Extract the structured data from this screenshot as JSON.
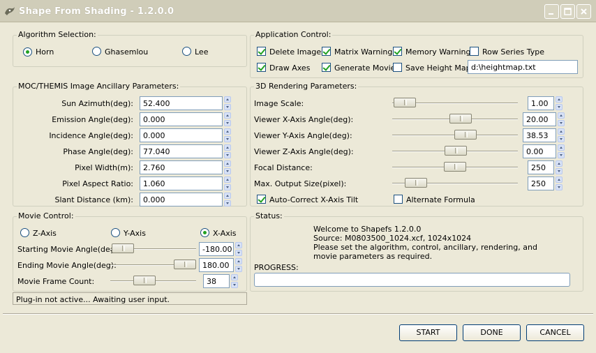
{
  "window": {
    "title": "Shape From Shading - 1.2.0.0"
  },
  "algorithm": {
    "legend": "Algorithm Selection:",
    "options": [
      "Horn",
      "Ghasemlou",
      "Lee"
    ],
    "selected": "Horn"
  },
  "app_control": {
    "legend": "Application Control:",
    "delete_images": {
      "label": "Delete Images",
      "checked": true
    },
    "matrix_warnings": {
      "label": "Matrix Warnings",
      "checked": true
    },
    "memory_warnings": {
      "label": "Memory Warnings",
      "checked": true
    },
    "row_series_type": {
      "label": "Row Series Type",
      "checked": false
    },
    "draw_axes": {
      "label": "Draw Axes",
      "checked": true
    },
    "generate_movie": {
      "label": "Generate Movie",
      "checked": true
    },
    "save_height_map": {
      "label": "Save Height Map",
      "checked": false
    },
    "height_map_path": "d:\\heightmap.txt"
  },
  "ancillary": {
    "legend": "MOC/THEMIS Image Ancillary Parameters:",
    "params": [
      {
        "label": "Sun Azimuth(deg):",
        "value": "52.400"
      },
      {
        "label": "Emission Angle(deg):",
        "value": "0.000"
      },
      {
        "label": "Incidence Angle(deg):",
        "value": "0.000"
      },
      {
        "label": "Phase Angle(deg):",
        "value": "77.040"
      },
      {
        "label": "Pixel Width(m):",
        "value": "2.760"
      },
      {
        "label": "Pixel Aspect Ratio:",
        "value": "1.060"
      },
      {
        "label": "Slant Distance (km):",
        "value": "0.000"
      }
    ]
  },
  "rendering": {
    "legend": "3D Rendering Parameters:",
    "params": [
      {
        "label": "Image Scale:",
        "value": "1.00"
      },
      {
        "label": "Viewer X-Axis Angle(deg):",
        "value": "20.00"
      },
      {
        "label": "Viewer Y-Axis Angle(deg):",
        "value": "38.53"
      },
      {
        "label": "Viewer Z-Axis Angle(deg):",
        "value": "0.00"
      },
      {
        "label": "Focal Distance:",
        "value": "250"
      },
      {
        "label": "Max. Output Size(pixel):",
        "value": "250"
      }
    ],
    "auto_correct": {
      "label": "Auto-Correct X-Axis Tilt",
      "checked": true
    },
    "alternate_formula": {
      "label": "Alternate Formula",
      "checked": false
    }
  },
  "movie": {
    "legend": "Movie Control:",
    "axes": [
      "Z-Axis",
      "Y-Axis",
      "X-Axis"
    ],
    "selected_axis": "X-Axis",
    "start": {
      "label": "Starting Movie Angle(deg):",
      "value": "-180.00"
    },
    "end": {
      "label": "Ending Movie Angle(deg):",
      "value": "180.00"
    },
    "frames": {
      "label": "Movie Frame Count:",
      "value": "38"
    }
  },
  "plugin_status": "Plug-in not active... Awaiting user input.",
  "status": {
    "legend": "Status:",
    "lines": [
      "Welcome to Shapefs 1.2.0.0",
      "Source: M0803500_1024.xcf, 1024x1024",
      "Please set the algorithm, control, ancillary, rendering, and",
      "movie parameters as required."
    ],
    "progress_label": "PROGRESS:",
    "progress": 0
  },
  "buttons": {
    "start": "START",
    "done": "DONE",
    "cancel": "CANCEL"
  }
}
